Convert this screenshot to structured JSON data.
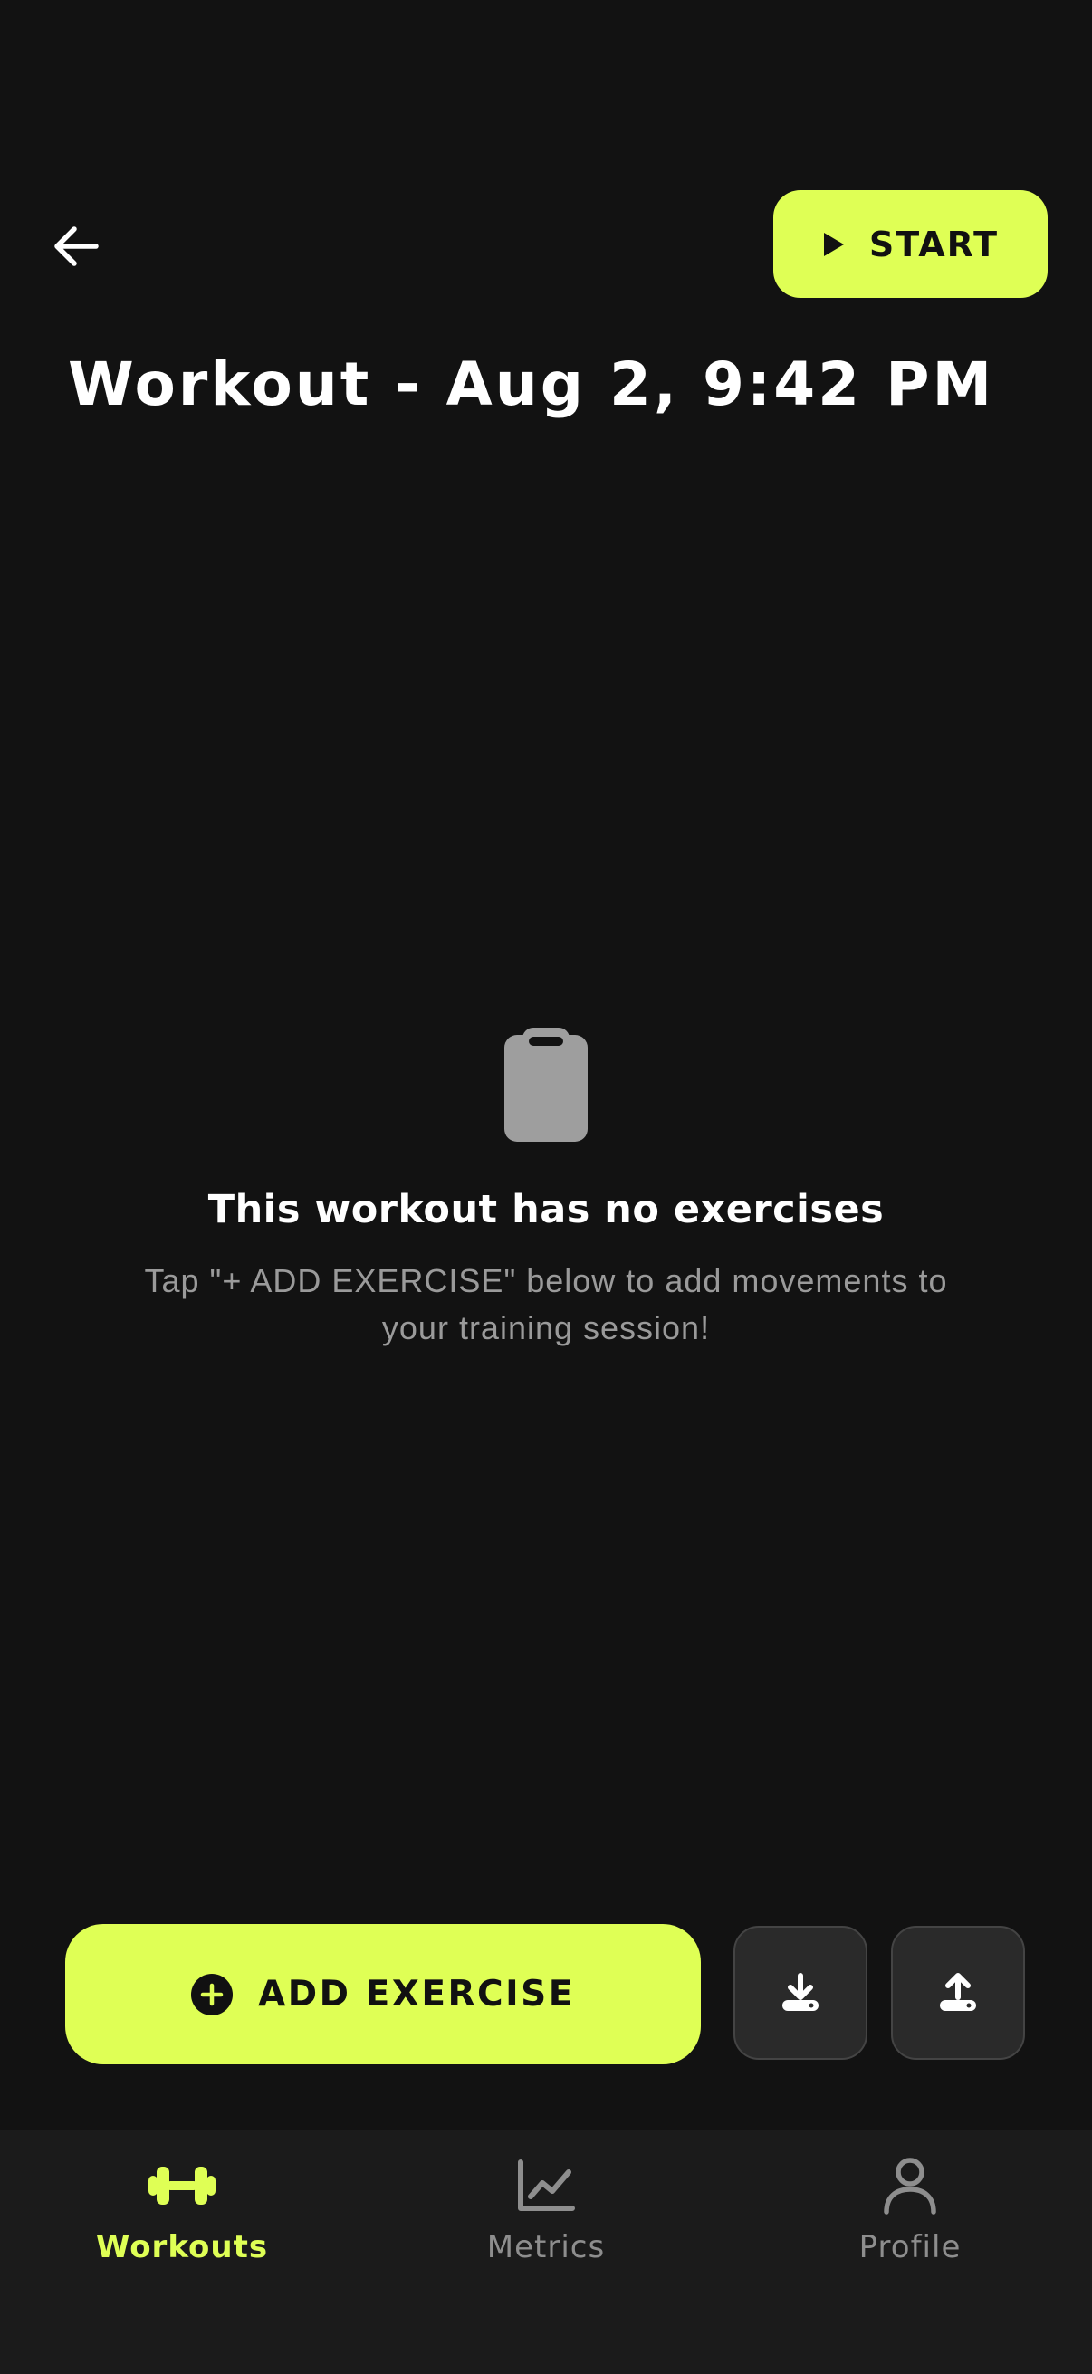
{
  "header": {
    "back_icon": "arrow-left-icon",
    "start_label": "START",
    "start_icon": "play-icon",
    "title": "Workout - Aug 2, 9:42 PM"
  },
  "empty_state": {
    "icon": "clipboard-icon",
    "title": "This workout has no exercises",
    "subtitle": "Tap \"+ ADD EXERCISE\" below to add movements to your training session!"
  },
  "actions": {
    "add_exercise_label": "ADD EXERCISE",
    "add_icon": "plus-circle-icon",
    "import_icon": "download-icon",
    "export_icon": "upload-icon"
  },
  "nav": {
    "items": [
      {
        "label": "Workouts",
        "icon": "dumbbell-icon",
        "active": true
      },
      {
        "label": "Metrics",
        "icon": "chart-line-icon",
        "active": false
      },
      {
        "label": "Profile",
        "icon": "person-icon",
        "active": false
      }
    ]
  },
  "colors": {
    "background": "#121212",
    "accent": "#DFFF55",
    "nav_background": "#1b1b1b",
    "muted_text": "#9a9a9a"
  }
}
